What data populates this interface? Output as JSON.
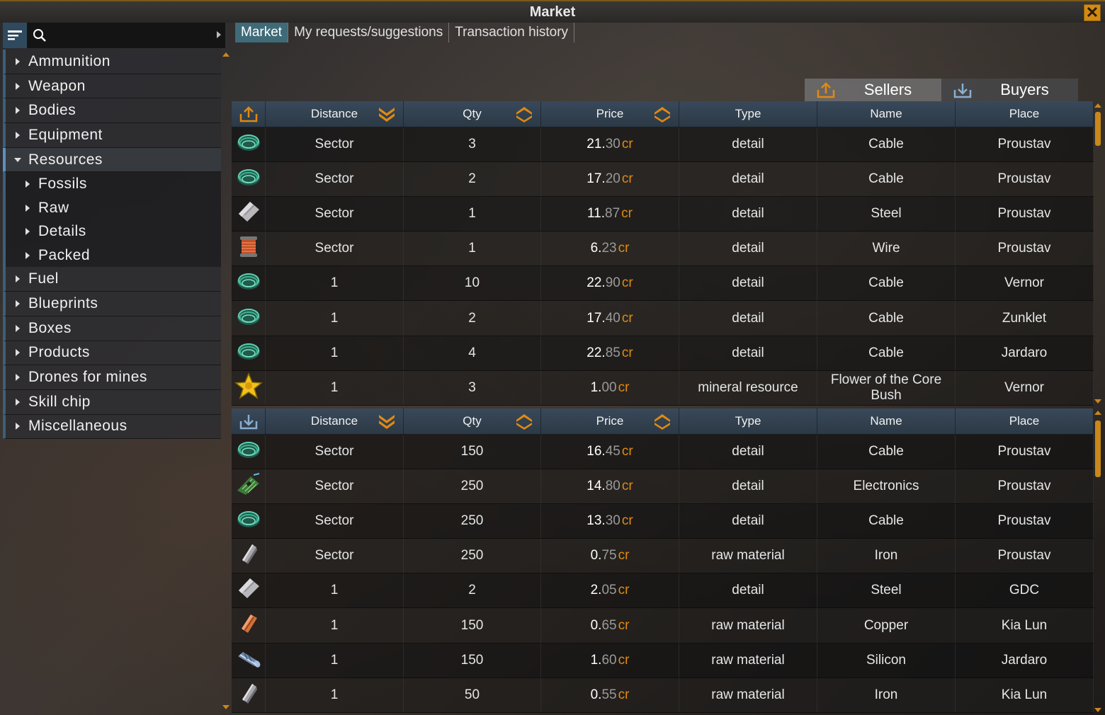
{
  "window": {
    "title": "Market",
    "close_label": "✕"
  },
  "colors": {
    "accent": "#e08a12",
    "tab_active": "#3f6a78",
    "header": "#2c3946"
  },
  "tabs": [
    {
      "label": "Market",
      "active": true
    },
    {
      "label": "My requests/suggestions",
      "active": false
    },
    {
      "label": "Transaction history",
      "active": false
    }
  ],
  "categories": [
    {
      "label": "Ammunition"
    },
    {
      "label": "Weapon"
    },
    {
      "label": "Bodies"
    },
    {
      "label": "Equipment"
    },
    {
      "label": "Resources",
      "open": true,
      "children": [
        {
          "label": "Fossils"
        },
        {
          "label": "Raw"
        },
        {
          "label": "Details"
        },
        {
          "label": "Packed"
        }
      ]
    },
    {
      "label": "Fuel"
    },
    {
      "label": "Blueprints"
    },
    {
      "label": "Boxes"
    },
    {
      "label": "Products"
    },
    {
      "label": "Drones for mines"
    },
    {
      "label": "Skill chip"
    },
    {
      "label": "Miscellaneous"
    }
  ],
  "switch": {
    "sellers": "Sellers",
    "buyers": "Buyers"
  },
  "columns": {
    "distance": "Distance",
    "qty": "Qty",
    "price": "Price",
    "type": "Type",
    "name": "Name",
    "place": "Place"
  },
  "currency": "cr",
  "sellers": [
    {
      "icon": "cable-icon",
      "distance": "Sector",
      "qty": "3",
      "price_int": "21.",
      "price_dec": "30",
      "type": "detail",
      "name": "Cable",
      "place": "Proustav"
    },
    {
      "icon": "cable-icon",
      "distance": "Sector",
      "qty": "2",
      "price_int": "17.",
      "price_dec": "20",
      "type": "detail",
      "name": "Cable",
      "place": "Proustav"
    },
    {
      "icon": "steel-icon",
      "distance": "Sector",
      "qty": "1",
      "price_int": "11.",
      "price_dec": "87",
      "type": "detail",
      "name": "Steel",
      "place": "Proustav"
    },
    {
      "icon": "wire-icon",
      "distance": "Sector",
      "qty": "1",
      "price_int": "6.",
      "price_dec": "23",
      "type": "detail",
      "name": "Wire",
      "place": "Proustav"
    },
    {
      "icon": "cable-icon",
      "distance": "1",
      "qty": "10",
      "price_int": "22.",
      "price_dec": "90",
      "type": "detail",
      "name": "Cable",
      "place": "Vernor"
    },
    {
      "icon": "cable-icon",
      "distance": "1",
      "qty": "2",
      "price_int": "17.",
      "price_dec": "40",
      "type": "detail",
      "name": "Cable",
      "place": "Zunklet"
    },
    {
      "icon": "cable-icon",
      "distance": "1",
      "qty": "4",
      "price_int": "22.",
      "price_dec": "85",
      "type": "detail",
      "name": "Cable",
      "place": "Jardaro"
    },
    {
      "icon": "flower-icon",
      "distance": "1",
      "qty": "3",
      "price_int": "1.",
      "price_dec": "00",
      "type": "mineral resource",
      "name": "Flower of the Core Bush",
      "place": "Vernor"
    }
  ],
  "buyers": [
    {
      "icon": "cable-icon",
      "distance": "Sector",
      "qty": "150",
      "price_int": "16.",
      "price_dec": "45",
      "type": "detail",
      "name": "Cable",
      "place": "Proustav"
    },
    {
      "icon": "electronics-icon",
      "distance": "Sector",
      "qty": "250",
      "price_int": "14.",
      "price_dec": "80",
      "type": "detail",
      "name": "Electronics",
      "place": "Proustav"
    },
    {
      "icon": "cable-icon",
      "distance": "Sector",
      "qty": "250",
      "price_int": "13.",
      "price_dec": "30",
      "type": "detail",
      "name": "Cable",
      "place": "Proustav"
    },
    {
      "icon": "iron-icon",
      "distance": "Sector",
      "qty": "250",
      "price_int": "0.",
      "price_dec": "75",
      "type": "raw material",
      "name": "Iron",
      "place": "Proustav"
    },
    {
      "icon": "steel-icon",
      "distance": "1",
      "qty": "2",
      "price_int": "2.",
      "price_dec": "05",
      "type": "detail",
      "name": "Steel",
      "place": "GDC"
    },
    {
      "icon": "copper-icon",
      "distance": "1",
      "qty": "150",
      "price_int": "0.",
      "price_dec": "65",
      "type": "raw material",
      "name": "Copper",
      "place": "Kia Lun"
    },
    {
      "icon": "silicon-icon",
      "distance": "1",
      "qty": "150",
      "price_int": "1.",
      "price_dec": "60",
      "type": "raw material",
      "name": "Silicon",
      "place": "Jardaro"
    },
    {
      "icon": "iron-icon",
      "distance": "1",
      "qty": "50",
      "price_int": "0.",
      "price_dec": "55",
      "type": "raw material",
      "name": "Iron",
      "place": "Kia Lun"
    }
  ]
}
